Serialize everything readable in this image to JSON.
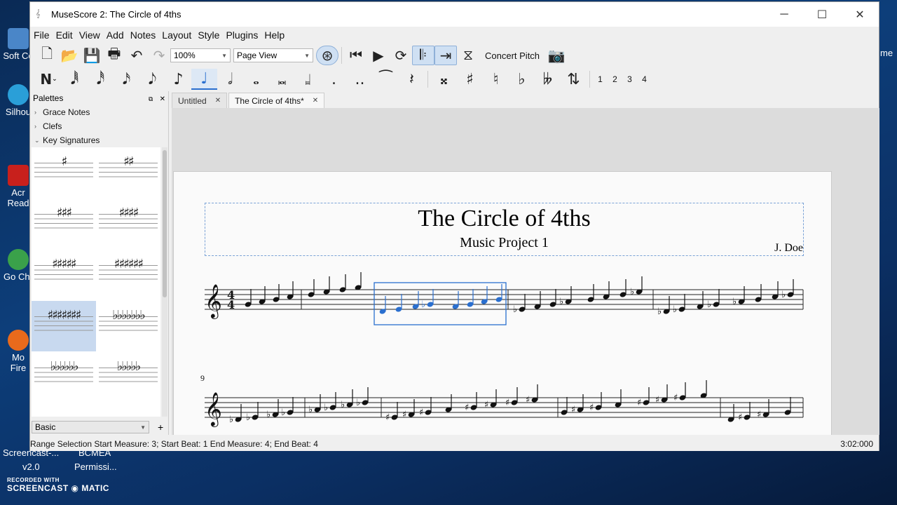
{
  "desktop": {
    "icons": [
      {
        "label": "Soft Ce"
      },
      {
        "label": "Silhou"
      },
      {
        "label": "Acr Read"
      },
      {
        "label": "Go Chr"
      },
      {
        "label": "Mo Fire"
      }
    ],
    "bottom_labels": [
      "Screencast-...",
      "BCMEA",
      "v2.0",
      "Permissi..."
    ],
    "recorder": {
      "small": "RECORDED WITH",
      "big_left": "SCREENCAST",
      "big_right": "MATIC"
    },
    "right_edge_text": "me"
  },
  "window": {
    "title": "MuseScore 2: The Circle of 4ths",
    "controls": {
      "minimize": "─",
      "maximize": "☐",
      "close": "✕"
    }
  },
  "menu": [
    "File",
    "Edit",
    "View",
    "Add",
    "Notes",
    "Layout",
    "Style",
    "Plugins",
    "Help"
  ],
  "toolbar": {
    "zoom": "100%",
    "view_mode": "Page View",
    "concert_pitch": "Concert Pitch"
  },
  "note_toolbar": {
    "durations": [
      "𝅘𝅥𝅱",
      "𝅘𝅥𝅰",
      "𝅘𝅥𝅯",
      "𝅘𝅥𝅮",
      "♪",
      "♩",
      "𝅗𝅥",
      "𝅝",
      "𝅜",
      "𝆷"
    ],
    "active_index": 5,
    "accidentals": [
      "𝄪",
      "♯",
      "♮",
      "♭",
      "𝄫"
    ],
    "voices": [
      "1",
      "2",
      "3",
      "4"
    ]
  },
  "palettes": {
    "header": "Palettes",
    "items": [
      {
        "label": "Grace Notes",
        "chevron": "›"
      },
      {
        "label": "Clefs",
        "chevron": "›"
      },
      {
        "label": "Key Signatures",
        "chevron": "⌄"
      }
    ],
    "key_signatures": [
      {
        "sym": "♯",
        "selected": false
      },
      {
        "sym": "♯♯",
        "selected": false
      },
      {
        "sym": "♯♯♯",
        "selected": false
      },
      {
        "sym": "♯♯♯♯",
        "selected": false
      },
      {
        "sym": "♯♯♯♯♯",
        "selected": false
      },
      {
        "sym": "♯♯♯♯♯♯",
        "selected": false
      },
      {
        "sym": "♯♯♯♯♯♯♯",
        "selected": true
      },
      {
        "sym": "♭♭♭♭♭♭♭",
        "selected": false
      },
      {
        "sym": "♭♭♭♭♭♭",
        "selected": false
      },
      {
        "sym": "♭♭♭♭♭",
        "selected": false
      }
    ],
    "footer_select": "Basic",
    "add_button": "+"
  },
  "tabs": [
    {
      "label": "Untitled",
      "active": false
    },
    {
      "label": "The Circle of 4ths*",
      "active": true
    }
  ],
  "score": {
    "title": "The Circle of 4ths",
    "subtitle": "Music Project 1",
    "composer": "J. Doe",
    "time_signature": {
      "top": "4",
      "bottom": "4"
    },
    "system2_measure_number": "9"
  },
  "status": {
    "left": "Range Selection Start Measure: 3; Start Beat: 1 End Measure: 4; End Beat: 4",
    "right": "3:02:000"
  },
  "colors": {
    "selection": "#2a6fcf"
  }
}
